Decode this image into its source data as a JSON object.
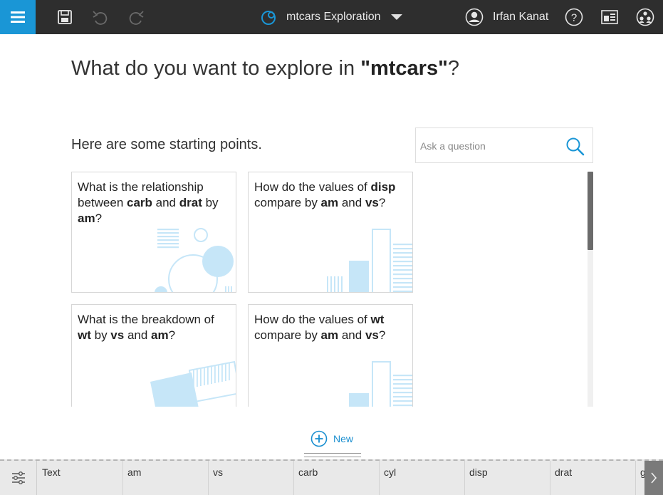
{
  "header": {
    "title": "mtcars Exploration",
    "user_name": "Irfan Kanat",
    "icons": [
      "menu-icon",
      "save-icon",
      "undo-icon",
      "redo-icon",
      "exploration-icon",
      "chevron-down-icon",
      "user-avatar-icon",
      "help-icon",
      "presentation-icon",
      "share-icon"
    ]
  },
  "main": {
    "heading_prefix": "What do you want to explore in ",
    "heading_dataset": "\"mtcars\"",
    "heading_suffix": "?",
    "subheading": "Here are some starting points.",
    "ask_placeholder": "Ask a question",
    "new_label": "New"
  },
  "cards": [
    {
      "parts": [
        {
          "t": "What is the relationship between ",
          "b": false
        },
        {
          "t": "carb",
          "b": true
        },
        {
          "t": " and ",
          "b": false
        },
        {
          "t": "drat",
          "b": true
        },
        {
          "t": " by ",
          "b": false
        },
        {
          "t": "am",
          "b": true
        },
        {
          "t": "?",
          "b": false
        }
      ]
    },
    {
      "parts": [
        {
          "t": "How do the values of ",
          "b": false
        },
        {
          "t": "disp",
          "b": true
        },
        {
          "t": " compare by ",
          "b": false
        },
        {
          "t": "am",
          "b": true
        },
        {
          "t": " and ",
          "b": false
        },
        {
          "t": "vs",
          "b": true
        },
        {
          "t": "?",
          "b": false
        }
      ]
    },
    {
      "parts": [
        {
          "t": "What is the breakdown of ",
          "b": false
        },
        {
          "t": "wt",
          "b": true
        },
        {
          "t": " by ",
          "b": false
        },
        {
          "t": "vs",
          "b": true
        },
        {
          "t": " and ",
          "b": false
        },
        {
          "t": "am",
          "b": true
        },
        {
          "t": "?",
          "b": false
        }
      ]
    },
    {
      "parts": [
        {
          "t": "How do the values of ",
          "b": false
        },
        {
          "t": "wt",
          "b": true
        },
        {
          "t": " compare by ",
          "b": false
        },
        {
          "t": "am",
          "b": true
        },
        {
          "t": " and ",
          "b": false
        },
        {
          "t": "vs",
          "b": true
        },
        {
          "t": "?",
          "b": false
        }
      ]
    }
  ],
  "columns": [
    "Text",
    "am",
    "vs",
    "carb",
    "cyl",
    "disp",
    "drat",
    "g"
  ],
  "colors": {
    "accent": "#1a96d6",
    "topbar": "#2e2e2e",
    "illustration": "#c6e6f8"
  }
}
